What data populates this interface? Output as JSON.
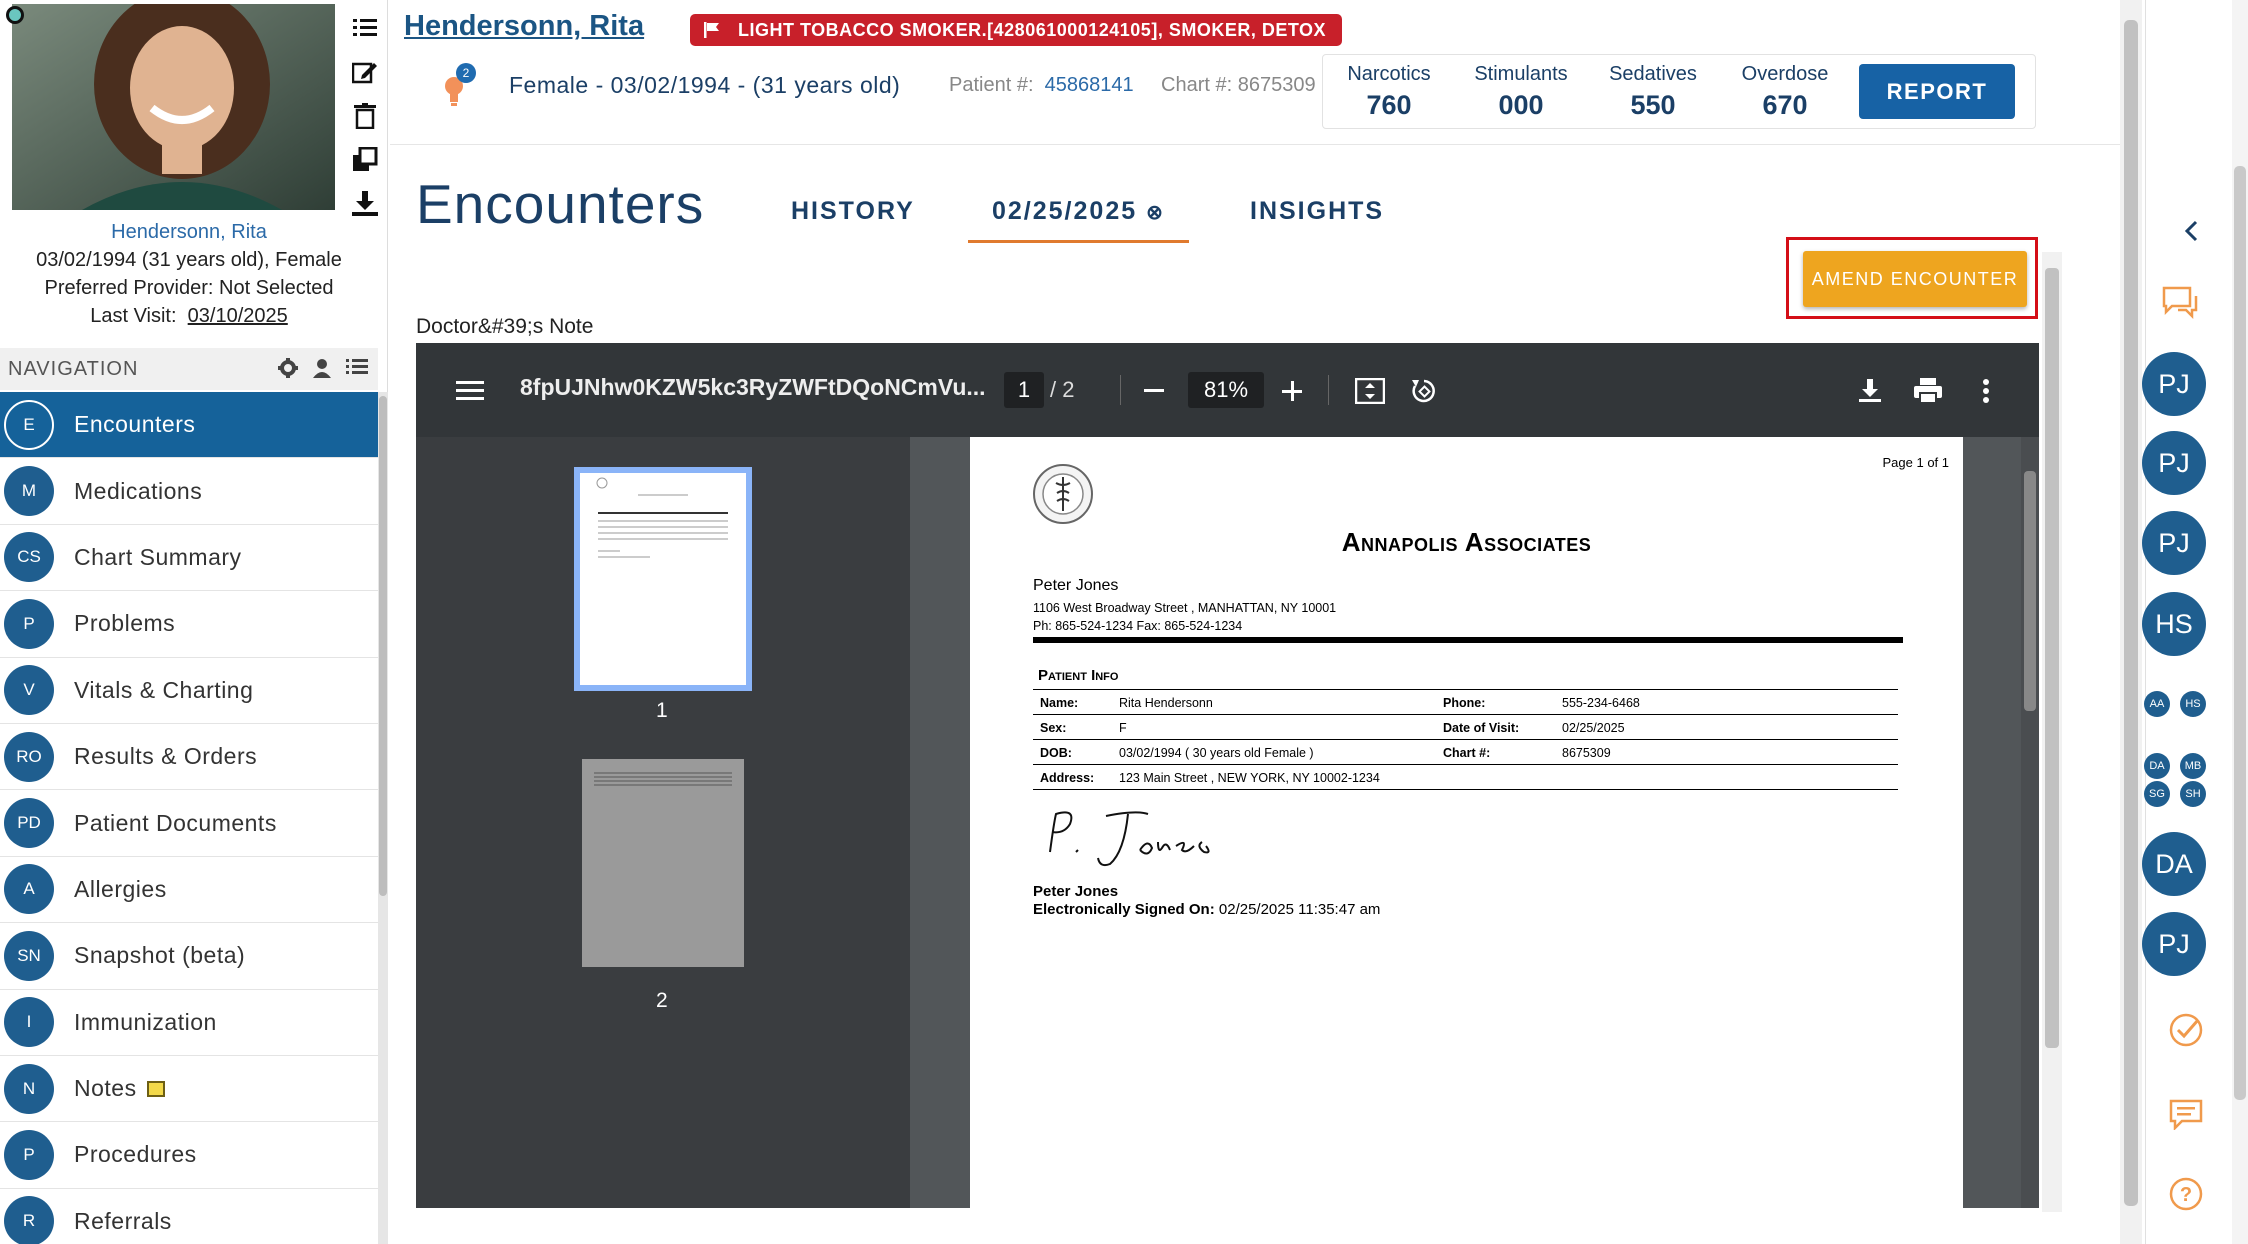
{
  "patient": {
    "title_name": "Hendersonn, Rita",
    "alert": "LIGHT TOBACCO SMOKER.[428061000124105], SMOKER, DETOX",
    "insights_count": "2",
    "demographics": "Female - 03/02/1994 - (31 years old)",
    "patient_num_label": "Patient #:",
    "patient_num": "45868141",
    "chart_num": "Chart #: 8675309",
    "card_name": "Hendersonn, Rita",
    "card_dob": "03/02/1994 (31 years old), Female",
    "card_provider": "Preferred Provider: Not Selected",
    "card_last_visit_label": "Last Visit:",
    "card_last_visit": "03/10/2025"
  },
  "stats": [
    {
      "label": "Narcotics",
      "value": "760"
    },
    {
      "label": "Stimulants",
      "value": "000"
    },
    {
      "label": "Sedatives",
      "value": "550"
    },
    {
      "label": "Overdose",
      "value": "670"
    }
  ],
  "report_label": "REPORT",
  "navigation": {
    "heading": "NAVIGATION",
    "items": [
      {
        "abbr": "E",
        "label": "Encounters"
      },
      {
        "abbr": "M",
        "label": "Medications"
      },
      {
        "abbr": "CS",
        "label": "Chart Summary"
      },
      {
        "abbr": "P",
        "label": "Problems"
      },
      {
        "abbr": "V",
        "label": "Vitals & Charting"
      },
      {
        "abbr": "RO",
        "label": "Results & Orders"
      },
      {
        "abbr": "PD",
        "label": "Patient Documents"
      },
      {
        "abbr": "A",
        "label": "Allergies"
      },
      {
        "abbr": "SN",
        "label": "Snapshot (beta)"
      },
      {
        "abbr": "I",
        "label": "Immunization"
      },
      {
        "abbr": "N",
        "label": "Notes"
      },
      {
        "abbr": "P",
        "label": "Procedures"
      },
      {
        "abbr": "R",
        "label": "Referrals"
      }
    ]
  },
  "encounters": {
    "title": "Encounters",
    "tabs": [
      "HISTORY",
      "02/25/2025",
      "INSIGHTS"
    ],
    "amend_label": "AMEND ENCOUNTER",
    "doc_label": "Doctor&#39;s Note"
  },
  "pdf": {
    "filename": "8fpUJNhw0KZW5kc3RyZWFtDQoNCmVu...",
    "page": "1",
    "page_total": "/  2",
    "zoom": "81%",
    "thumb_nums": [
      "1",
      "2"
    ],
    "page_of": "Page 1 of 1",
    "practice": "Annapolis Associates",
    "doctor": "Peter Jones",
    "address": "1106 West Broadway Street , MANHATTAN, NY 10001",
    "phone_fax": "Ph: 865-524-1234 Fax: 865-524-1234",
    "patient_info_heading": "Patient Info",
    "rows": [
      {
        "l1": "Name:",
        "v1": "Rita Hendersonn",
        "l2": "Phone:",
        "v2": "555-234-6468"
      },
      {
        "l1": "Sex:",
        "v1": "F",
        "l2": "Date of Visit:",
        "v2": "02/25/2025"
      },
      {
        "l1": "DOB:",
        "v1": "03/02/1994 ( 30 years old Female )",
        "l2": "Chart #:",
        "v2": "8675309"
      },
      {
        "l1": "Address:",
        "v1": "123 Main Street , NEW YORK, NY 10002-1234",
        "l2": "",
        "v2": ""
      }
    ],
    "signer": "Peter Jones",
    "esig_label": "Electronically Signed On:",
    "esig_value": "02/25/2025 11:35:47 am"
  },
  "rail": {
    "avatars_large_top": [
      "PJ",
      "PJ",
      "PJ",
      "HS"
    ],
    "avatars_small_row1": [
      "AA",
      "HS"
    ],
    "avatars_small_grid": [
      "DA",
      "MB",
      "SG",
      "SH"
    ],
    "avatars_large_bottom": [
      "DA",
      "PJ"
    ]
  },
  "colors": {
    "brand": "#1b5584",
    "accent": "#eea51f",
    "alert": "#c8202a",
    "active_nav": "#15629a"
  },
  "icons": [
    "list-icon",
    "edit-icon",
    "trash-icon",
    "copy-icon",
    "download-icon",
    "flag-icon",
    "lightbulb-icon",
    "gear-icon",
    "user-icon",
    "menu-icon",
    "print-icon",
    "more-icon",
    "chat-icon",
    "check-icon",
    "message-icon",
    "help-icon",
    "chevron-left-icon"
  ]
}
